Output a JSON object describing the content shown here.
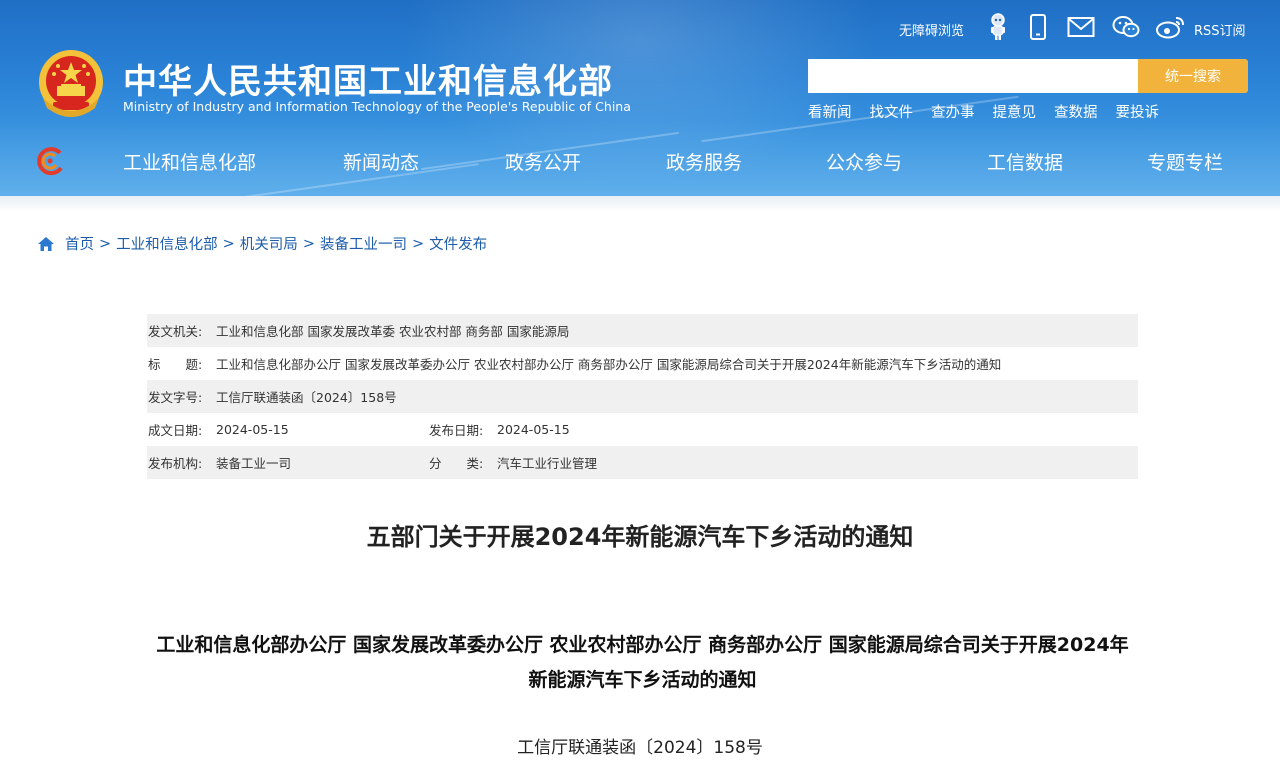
{
  "header": {
    "title_cn": "中华人民共和国工业和信息化部",
    "title_en": "Ministry of Industry and Information Technology of the People's Republic of China",
    "utility": {
      "accessibility": "无障碍浏览",
      "rss": "RSS订阅"
    },
    "search": {
      "placeholder": "",
      "button": "统一搜索"
    },
    "quick_links": [
      "看新闻",
      "找文件",
      "查办事",
      "提意见",
      "查数据",
      "要投诉"
    ],
    "nav": [
      "工业和信息化部",
      "新闻动态",
      "政务公开",
      "政务服务",
      "公众参与",
      "工信数据",
      "专题专栏"
    ]
  },
  "breadcrumb": [
    "首页",
    "工业和信息化部",
    "机关司局",
    "装备工业一司",
    "文件发布"
  ],
  "meta": {
    "issuer_label": "发文机关:",
    "issuer": "工业和信息化部 国家发展改革委 农业农村部 商务部 国家能源局",
    "title_label": "标　　题:",
    "title": "工业和信息化部办公厅 国家发展改革委办公厅 农业农村部办公厅 商务部办公厅 国家能源局综合司关于开展2024年新能源汽车下乡活动的通知",
    "doc_no_label": "发文字号:",
    "doc_no": "工信厅联通装函〔2024〕158号",
    "written_label": "成文日期:",
    "written": "2024-05-15",
    "published_label": "发布日期:",
    "published": "2024-05-15",
    "org_label": "发布机构:",
    "org": "装备工业一司",
    "category_label": "分　　类:",
    "category": "汽车工业行业管理"
  },
  "document": {
    "title": "五部门关于开展2024年新能源汽车下乡活动的通知",
    "subtitle": "工业和信息化部办公厅 国家发展改革委办公厅 农业农村部办公厅 商务部办公厅 国家能源局综合司关于开展2024年新能源汽车下乡活动的通知",
    "number": "工信厅联通装函〔2024〕158号"
  },
  "colors": {
    "header_blue": "#2a82d6",
    "search_button": "#f2b33d",
    "link_blue": "#1c5cab",
    "meta_shade": "#f0f0f0"
  }
}
